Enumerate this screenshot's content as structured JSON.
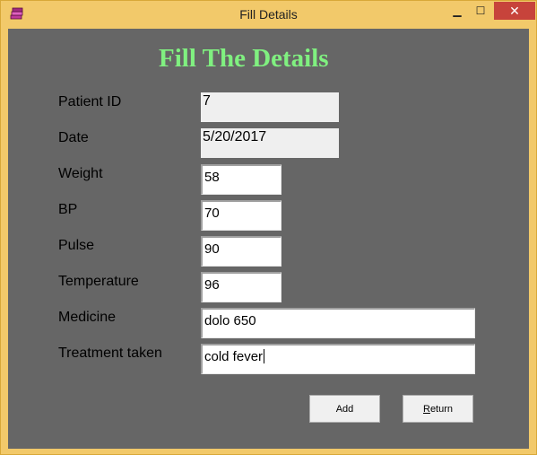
{
  "window": {
    "title": "Fill Details",
    "minimize_symbol": "▁",
    "maximize_symbol": "☐",
    "close_symbol": "✕"
  },
  "form": {
    "heading": "Fill The Details",
    "fields": {
      "patient_id": {
        "label": "Patient ID",
        "value": "7"
      },
      "date": {
        "label": "Date",
        "value": "5/20/2017"
      },
      "weight": {
        "label": "Weight",
        "value": "58"
      },
      "bp": {
        "label": "BP",
        "value": "70"
      },
      "pulse": {
        "label": "Pulse",
        "value": "90"
      },
      "temperature": {
        "label": "Temperature",
        "value": "96"
      },
      "medicine": {
        "label": "Medicine",
        "value": "dolo 650"
      },
      "treatment": {
        "label": "Treatment taken",
        "value": "cold fever"
      }
    }
  },
  "buttons": {
    "add": "Add",
    "return": "Return"
  },
  "colors": {
    "heading": "#80f080",
    "background": "#666666",
    "frame": "#f2c96a"
  },
  "icons": {
    "app": "books-icon"
  }
}
